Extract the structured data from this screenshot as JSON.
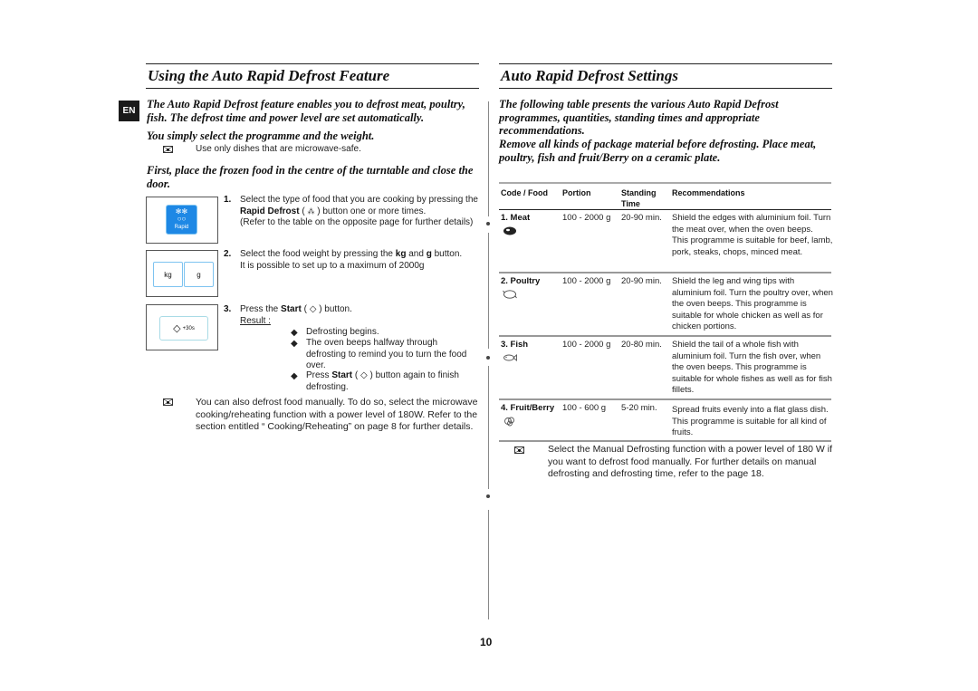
{
  "language_badge": "EN",
  "left": {
    "title": "Using the Auto Rapid Defrost Feature",
    "intro": "The Auto Rapid Defrost feature enables you to defrost meat, poultry, fish. The defrost time and power level are set automatically.",
    "instruction": "You simply select the programme and the weight.",
    "note1": "Use only dishes that are microwave-safe.",
    "first_step": "First, place the frozen food in the centre of the turntable and close the door.",
    "illustrations": {
      "rapid_button_label": "Rapid",
      "kg_label": "kg",
      "g_label": "g",
      "start_suffix": "+30s"
    },
    "steps": [
      {
        "num": "1.",
        "line1": "Select the type of food that you are cooking by pressing the",
        "bold": "Rapid Defrost",
        "line2_after": " button one or more times.",
        "line3": "(Refer to the table on the opposite page for further details)"
      },
      {
        "num": "2.",
        "line1_pre": "Select the food weight by pressing the ",
        "bold1": "kg",
        "mid": " and ",
        "bold2": "g",
        "line1_post": " button.",
        "line2": "It is possible to set up to a maximum of 2000g"
      },
      {
        "num": "3.",
        "pre": "Press the ",
        "bold": "Start",
        "post": " button.",
        "result_label": "Result :",
        "bullets": [
          "Defrosting begins.",
          "The oven beeps halfway through defrosting to remind you to turn the food over.",
          "button again to finish defrosting."
        ],
        "bullet3_pre": "Press ",
        "bullet3_bold": "Start"
      }
    ],
    "note2": "You can also defrost food manually. To do so, select the microwave cooking/reheating function with a power level of 180W. Refer to the section entitled “ Cooking/Reheating” on page 8 for further details."
  },
  "right": {
    "title": "Auto Rapid Defrost Settings",
    "intro1": "The following table presents the various Auto Rapid Defrost programmes, quantities, standing times and appropriate recommendations.",
    "intro2": "Remove all kinds of package material before defrosting. Place meat, poultry, fish and fruit/Berry on a ceramic plate.",
    "table": {
      "headers": [
        "Code / Food",
        "Portion",
        "Standing Time",
        "Recommendations"
      ],
      "rows": [
        {
          "food": "1. Meat",
          "icon": "meat-icon",
          "portion": "100 - 2000 g",
          "standing": "20-90 min.",
          "recommendation": "Shield the edges with aluminium foil. Turn the meat over, when the oven beeps.\nThis programme is suitable for beef, lamb, pork, steaks, chops, minced meat."
        },
        {
          "food": "2. Poultry",
          "icon": "poultry-icon",
          "portion": "100 - 2000 g",
          "standing": "20-90 min.",
          "recommendation": "Shield the leg and wing tips with aluminium foil. Turn the poultry over, when the oven beeps. This programme is suitable for whole chicken as well as for chicken portions."
        },
        {
          "food": "3. Fish",
          "icon": "fish-icon",
          "portion": "100 - 2000 g",
          "standing": "20-80 min.",
          "recommendation": "Shield the tail of a whole fish with aluminium foil. Turn the fish over, when the oven beeps. This programme is suitable for whole fishes as well as for fish fillets."
        },
        {
          "food": "4. Fruit/Berry",
          "icon": "fruit-icon",
          "portion": "100 - 600 g",
          "standing": "5-20 min.",
          "recommendation": "Spread fruits evenly into a flat glass dish. This programme is suitable for all kind of fruits."
        }
      ]
    },
    "note": "Select the Manual Defrosting function with a power level of 180 W if you want to defrost food manually. For further details on manual defrosting and defrosting time, refer to the page 18."
  },
  "page_number": "10",
  "colors": {
    "rapid_button_blue": "#1e88e5",
    "button_outline_blue": "#7ec3f0"
  }
}
